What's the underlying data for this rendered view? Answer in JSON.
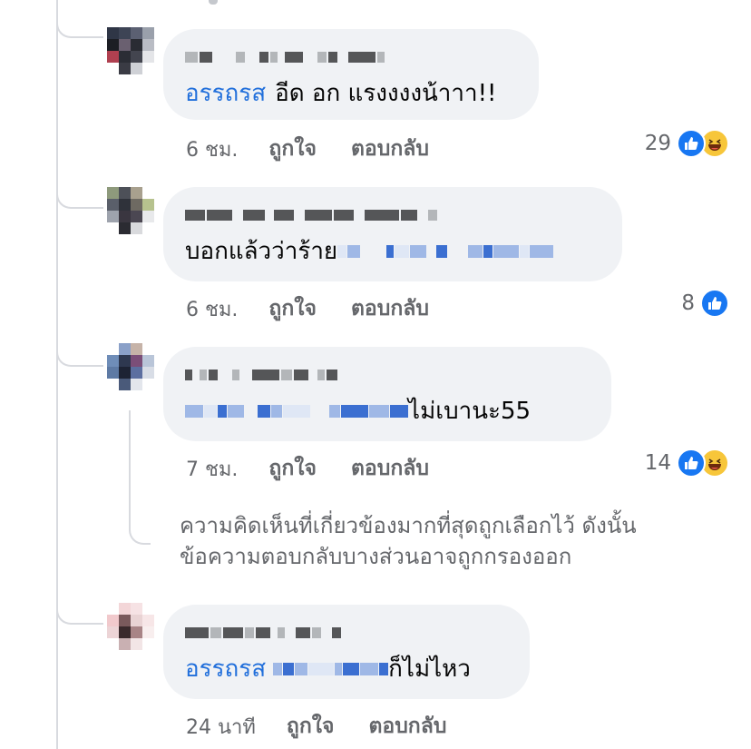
{
  "comments": [
    {
      "mention": "อรรถรส",
      "text": "อีด อก แรงงงงน้าาา!!",
      "time": "6 ชม.",
      "like_label": "ถูกใจ",
      "reply_label": "ตอบกลับ",
      "reaction_count": "29",
      "reactions": [
        "like-icon",
        "haha-icon"
      ]
    },
    {
      "text": "บอกแล้วว่าร้าย",
      "time": "6 ชม.",
      "like_label": "ถูกใจ",
      "reply_label": "ตอบกลับ",
      "reaction_count": "8",
      "reactions": [
        "like-icon"
      ]
    },
    {
      "text": "ไม่เบานะ55",
      "time": "7 ชม.",
      "like_label": "ถูกใจ",
      "reply_label": "ตอบกลับ",
      "reaction_count": "14",
      "reactions": [
        "like-icon",
        "haha-icon"
      ]
    },
    {
      "mention": "อรรถรส",
      "text": "ก็ไม่ไหว",
      "time": "24 นาที",
      "like_label": "ถูกใจ",
      "reply_label": "ตอบกลับ"
    }
  ],
  "filter_notice": {
    "line1": "ความคิดเห็นที่เกี่ยวข้องมากที่สุดถูกเลือกไว้ ดังนั้น",
    "line2": "ข้อความตอบกลับบางส่วนอาจถูกกรองออก"
  },
  "colors": {
    "bubble": "#f0f2f5",
    "mention": "#216fdb",
    "meta_text": "#65676b",
    "like_blue": "#1877f2",
    "haha_yellow": "#f7c63a"
  }
}
